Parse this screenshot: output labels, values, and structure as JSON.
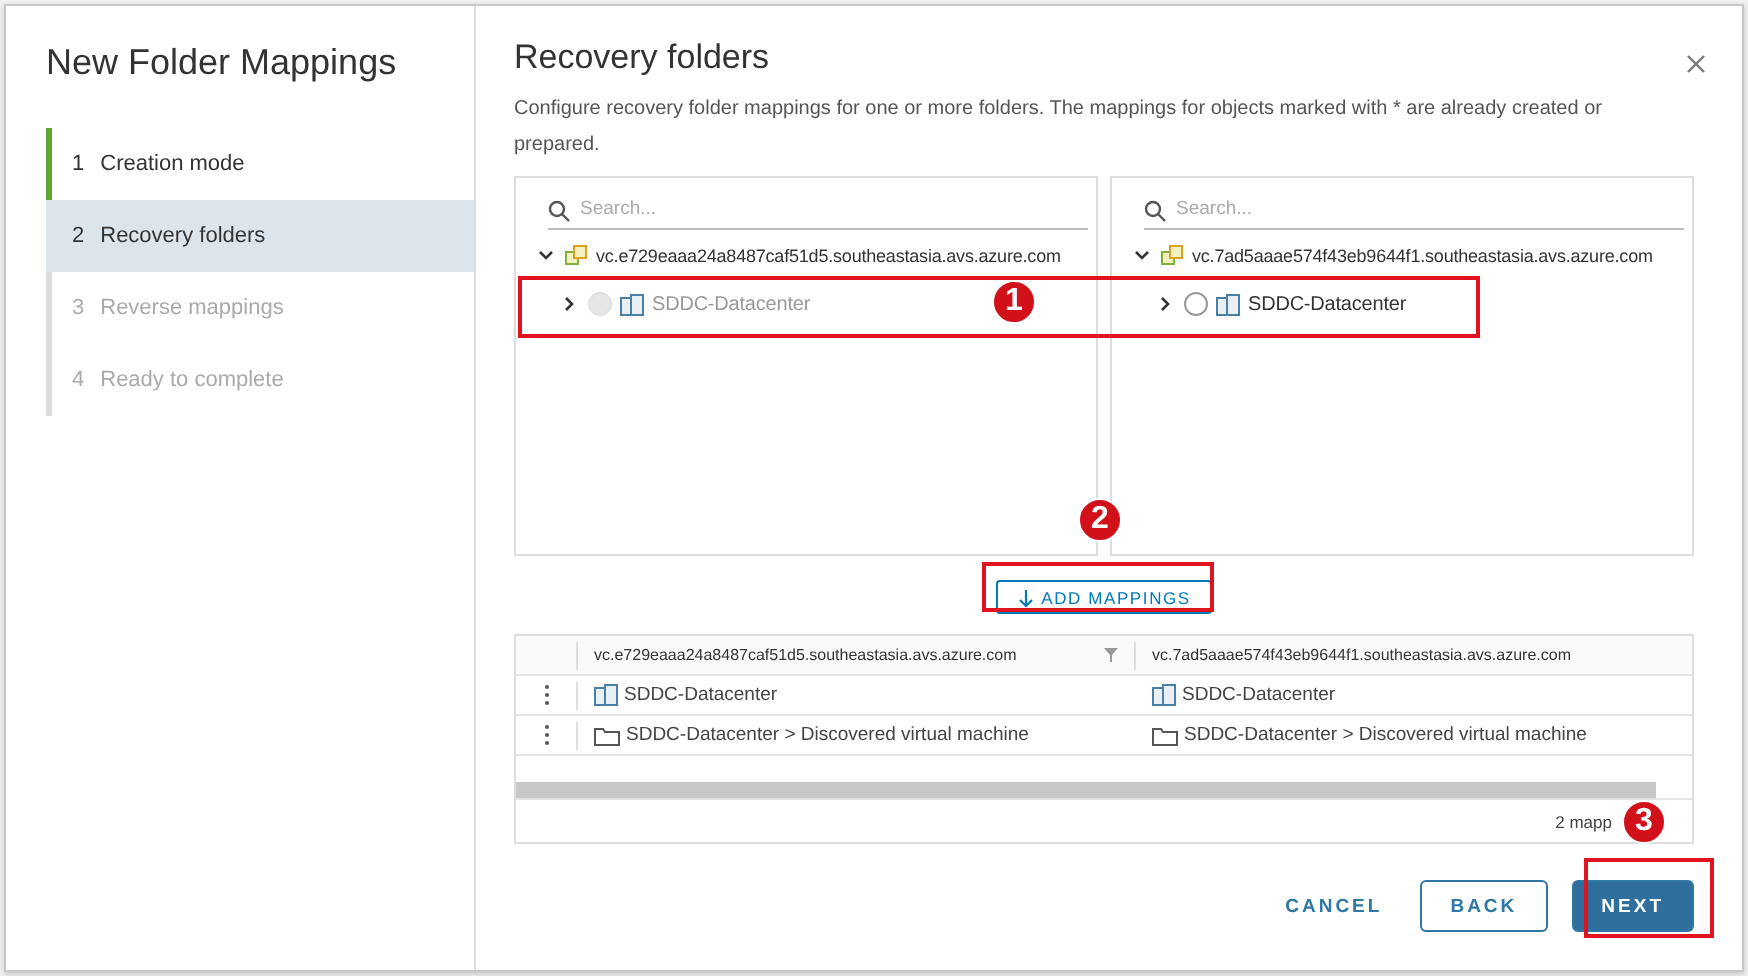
{
  "wizard": {
    "title": "New Folder Mappings",
    "steps": [
      {
        "number": "1",
        "label": "Creation mode",
        "completed": true,
        "selected": false,
        "disabled": false
      },
      {
        "number": "2",
        "label": "Recovery folders",
        "completed": false,
        "selected": true,
        "disabled": false
      },
      {
        "number": "3",
        "label": "Reverse mappings",
        "completed": false,
        "selected": false,
        "disabled": true
      },
      {
        "number": "4",
        "label": "Ready to complete",
        "completed": false,
        "selected": false,
        "disabled": true
      }
    ]
  },
  "content": {
    "title": "Recovery folders",
    "description": "Configure recovery folder mappings for one or more folders. The mappings for objects marked with * are already created or prepared.",
    "trees": [
      {
        "search_placeholder": "Search...",
        "root": {
          "label": "vc.e729eaaa24a8487caf51d5.southeastasia.avs.azure.com",
          "expanded": true,
          "children": [
            {
              "label": "SDDC-Datacenter",
              "expanded": false,
              "selected": false,
              "disabled": true
            }
          ]
        }
      },
      {
        "search_placeholder": "Search...",
        "root": {
          "label": "vc.7ad5aaae574f43eb9644f1.southeastasia.avs.azure.com",
          "expanded": true,
          "children": [
            {
              "label": "SDDC-Datacenter",
              "expanded": false,
              "selected": false,
              "disabled": false
            }
          ]
        }
      }
    ],
    "add_button": "ADD MAPPINGS",
    "table": {
      "columns": [
        "vc.e729eaaa24a8487caf51d5.southeastasia.avs.azure.com",
        "vc.7ad5aaae574f43eb9644f1.southeastasia.avs.azure.com"
      ],
      "rows": [
        {
          "cells": [
            {
              "kind": "datacenter",
              "text": "SDDC-Datacenter"
            },
            {
              "kind": "datacenter",
              "text": "SDDC-Datacenter"
            }
          ]
        },
        {
          "cells": [
            {
              "kind": "folder",
              "text": "SDDC-Datacenter > Discovered virtual machine"
            },
            {
              "kind": "folder",
              "text": "SDDC-Datacenter > Discovered virtual machine"
            }
          ]
        }
      ],
      "footer": "2 mapp"
    },
    "buttons": [
      {
        "kind": "flat",
        "label": "CANCEL"
      },
      {
        "kind": "outline",
        "label": "BACK"
      },
      {
        "kind": "primary",
        "label": "NEXT"
      }
    ]
  },
  "annotations": [
    {
      "number": "1"
    },
    {
      "number": "2"
    },
    {
      "number": "3"
    }
  ]
}
